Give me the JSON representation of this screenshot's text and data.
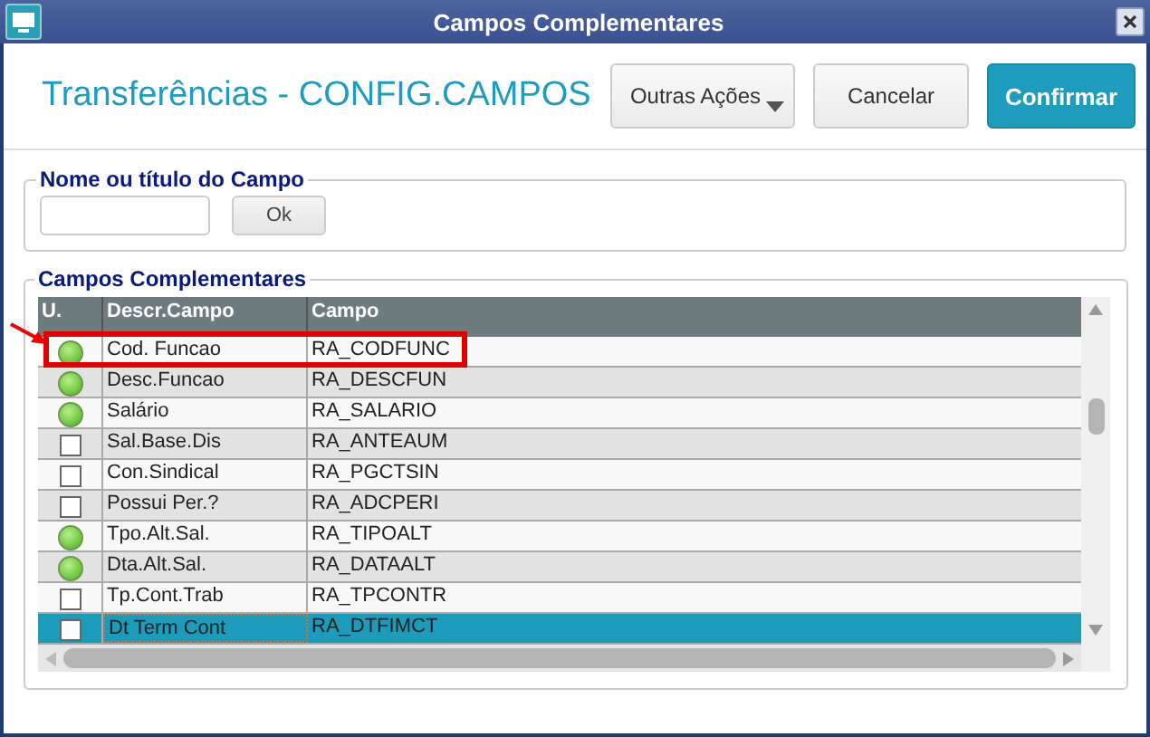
{
  "window": {
    "title": "Campos Complementares"
  },
  "header": {
    "title": "Transferências - CONFIG.CAMPOS",
    "buttons": [
      {
        "label": "Outras Ações",
        "kind": "menu"
      },
      {
        "label": "Cancelar",
        "kind": "plain"
      },
      {
        "label": "Confirmar",
        "kind": "primary"
      }
    ]
  },
  "search_group": {
    "legend": "Nome ou título do Campo",
    "button": "Ok"
  },
  "fields_group": {
    "legend": "Campos Complementares",
    "table": {
      "columns": [
        "U.",
        "Descr.Campo",
        "Campo"
      ],
      "rows": [
        {
          "used": true,
          "description": "Cod. Funcao",
          "field": "RA_CODFUNC",
          "selected": false,
          "highlighted": true
        },
        {
          "used": true,
          "description": "Desc.Funcao",
          "field": "RA_DESCFUN",
          "selected": false,
          "highlighted": false
        },
        {
          "used": true,
          "description": "Salário",
          "field": "RA_SALARIO",
          "selected": false,
          "highlighted": false
        },
        {
          "used": false,
          "description": "Sal.Base.Dis",
          "field": "RA_ANTEAUM",
          "selected": false,
          "highlighted": false
        },
        {
          "used": false,
          "description": "Con.Sindical",
          "field": "RA_PGCTSIN",
          "selected": false,
          "highlighted": false
        },
        {
          "used": false,
          "description": "Possui Per.?",
          "field": "RA_ADCPERI",
          "selected": false,
          "highlighted": false
        },
        {
          "used": true,
          "description": "Tpo.Alt.Sal.",
          "field": "RA_TIPOALT",
          "selected": false,
          "highlighted": false
        },
        {
          "used": true,
          "description": "Dta.Alt.Sal.",
          "field": "RA_DATAALT",
          "selected": false,
          "highlighted": false
        },
        {
          "used": false,
          "description": "Tp.Cont.Trab",
          "field": "RA_TPCONTR",
          "selected": false,
          "highlighted": false
        },
        {
          "used": false,
          "description": "Dt Term Cont",
          "field": "RA_DTFIMCT",
          "selected": true,
          "highlighted": false
        }
      ]
    }
  }
}
